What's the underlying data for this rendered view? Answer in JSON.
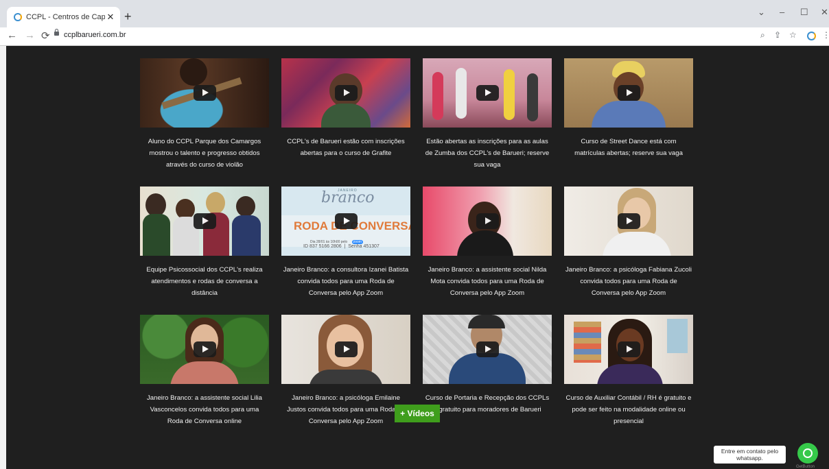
{
  "browser": {
    "tab_title": "CCPL - Centros de Capacitação P",
    "tab_close": "✕",
    "new_tab": "+",
    "url": "ccplbarueri.com.br",
    "window_controls": [
      "⌄",
      "–",
      "☐",
      "✕"
    ]
  },
  "videos": [
    {
      "caption": "Aluno do CCPL Parque dos Camargos mostrou o talento e progresso obtidos através do curso de violão",
      "thumb_icon": "guitar-video-thumbnail"
    },
    {
      "caption": "CCPL's de Barueri estão com inscrições abertas para o curso de Grafite",
      "thumb_icon": "graffiti-video-thumbnail"
    },
    {
      "caption": "Estão abertas as inscrições para as aulas de Zumba dos CCPL's de Barueri; reserve sua vaga",
      "thumb_icon": "zumba-video-thumbnail"
    },
    {
      "caption": "Curso de Street Dance está com matrículas abertas; reserve sua vaga",
      "thumb_icon": "street-dance-video-thumbnail"
    },
    {
      "caption": "Equipe Psicossocial dos CCPL's realiza atendimentos e rodas de conversa a distância",
      "thumb_icon": "team-video-thumbnail"
    },
    {
      "caption": "Janeiro Branco: a consultora Izanei Batista convida todos para uma Roda de Conversa pelo App Zoom",
      "thumb_icon": "roda-de-conversa-video-thumbnail"
    },
    {
      "caption": "Janeiro Branco: a assistente social Nilda Mota convida todos para uma Roda de Conversa pelo App Zoom",
      "thumb_icon": "nilda-video-thumbnail"
    },
    {
      "caption": "Janeiro Branco: a psicóloga Fabiana Zucoli convida todos para uma Roda de Conversa pelo App Zoom",
      "thumb_icon": "fabiana-video-thumbnail"
    },
    {
      "caption": "Janeiro Branco: a assistente social Lilia Vasconcelos convida todos para uma Roda de Conversa online",
      "thumb_icon": "lilia-video-thumbnail"
    },
    {
      "caption": "Janeiro Branco: a psicóloga Emilaine Justos convida todos para uma Roda de Conversa pelo App Zoom",
      "thumb_icon": "emilaine-video-thumbnail"
    },
    {
      "caption": "Curso de Portaria e Recepção dos CCPLs é gratuito para moradores de Barueri",
      "thumb_icon": "portaria-video-thumbnail"
    },
    {
      "caption": "Curso de Auxiliar Contábil / RH é gratuito e pode ser feito na modalidade online ou presencial",
      "thumb_icon": "auxiliar-contabil-video-thumbnail"
    }
  ],
  "roda_thumb": {
    "janeiro": "JANEIRO",
    "branco": "branco",
    "headline": "RODA DE CONVERSA",
    "date_line": "Dia 28/01 às 10h00 pelo",
    "zoom": "zoom",
    "id_line": "ID 837 5166 2806  |  Senha 451307"
  },
  "more_button": "+ Vídeos",
  "whatsapp": {
    "bubble_text": "Entre em contato pelo whatsapp.",
    "brand": "GetButton"
  },
  "colors": {
    "page_bg": "#1f1f1f",
    "button_green": "#3f9e1c",
    "whatsapp_green": "#36c94a"
  }
}
